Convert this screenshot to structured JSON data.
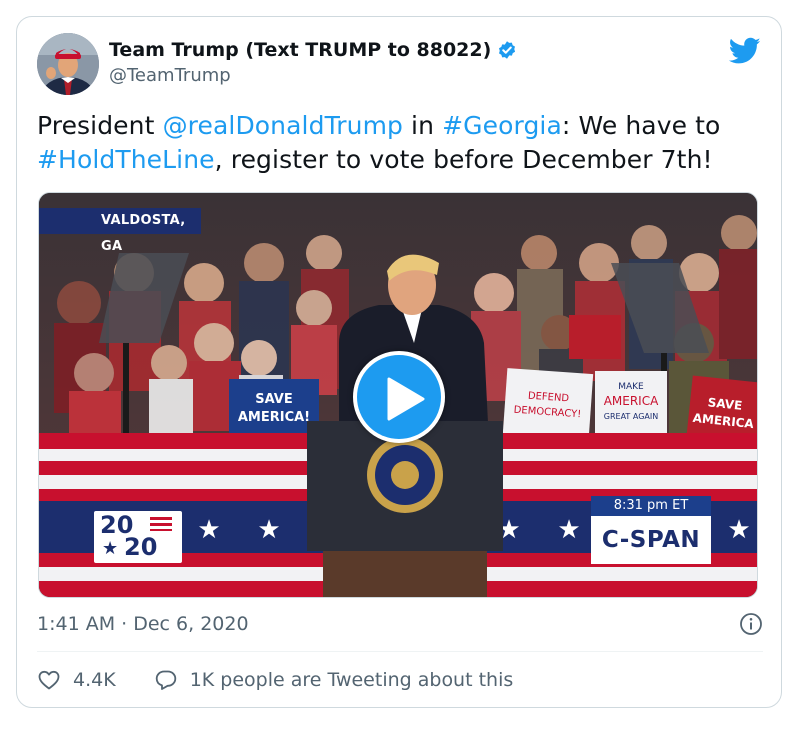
{
  "author": {
    "display_name": "Team Trump (Text TRUMP to 88022)",
    "handle": "@TeamTrump",
    "verified": true
  },
  "tweet": {
    "segments": [
      {
        "text": "President ",
        "link": false
      },
      {
        "text": "@realDonaldTrump",
        "link": true
      },
      {
        "text": " in ",
        "link": false
      },
      {
        "text": "#Georgia",
        "link": true
      },
      {
        "text": ": We have to ",
        "link": false
      },
      {
        "text": "#HoldTheLine",
        "link": true
      },
      {
        "text": ", register to vote before December 7th!",
        "link": false
      }
    ]
  },
  "media": {
    "location_label": "VALDOSTA, GA",
    "broadcast_time": "8:31 pm ET",
    "network_logo": "C-SPAN",
    "event_logo": {
      "top": "20",
      "bottom": "20"
    },
    "signs": [
      "SAVE AMERICA!",
      "DEFEND DEMOCRACY!",
      "MAKE AMERICA GREAT AGAIN",
      "SAVE AMERICA"
    ]
  },
  "timestamp": "1:41 AM · Dec 6, 2020",
  "actions": {
    "likes": "4.4K",
    "conversation": "1K people are Tweeting about this"
  },
  "colors": {
    "link": "#1d9bf0",
    "secondary_text": "#536471",
    "border": "#cfd9de",
    "twitter_blue": "#1d9bf0"
  },
  "icons": [
    "verified-badge-icon",
    "twitter-bird-icon",
    "play-icon",
    "info-icon",
    "heart-icon",
    "reply-bubble-icon"
  ]
}
